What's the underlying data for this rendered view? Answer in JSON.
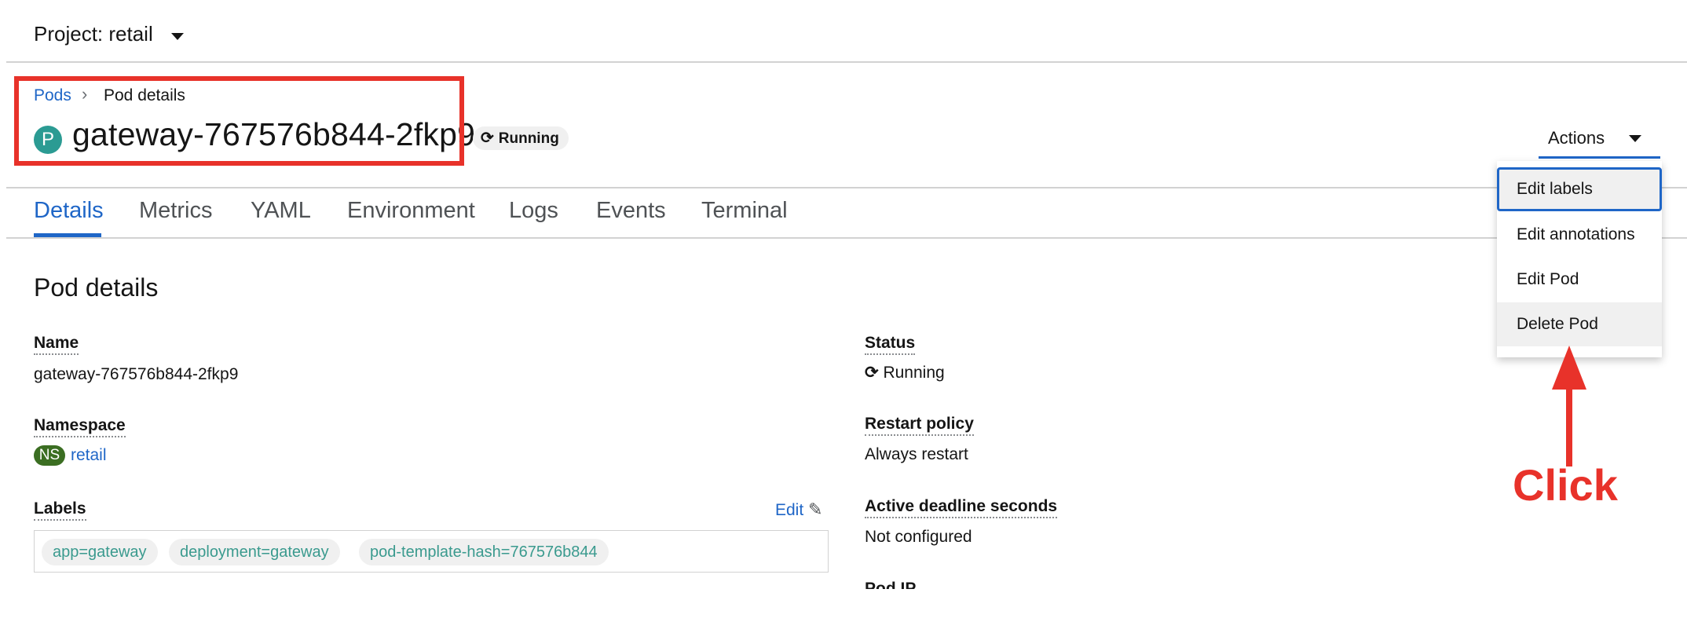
{
  "project": {
    "label": "Project: retail"
  },
  "breadcrumb": {
    "root": "Pods",
    "separator": "›",
    "current": "Pod details"
  },
  "header": {
    "badge": "P",
    "pod_name": "gateway-767576b844-2fkp9",
    "status": "Running",
    "actions_label": "Actions"
  },
  "tabs": [
    "Details",
    "Metrics",
    "YAML",
    "Environment",
    "Logs",
    "Events",
    "Terminal"
  ],
  "actions_menu": {
    "items": [
      "Edit labels",
      "Edit annotations",
      "Edit Pod",
      "Delete Pod"
    ]
  },
  "details": {
    "section_title": "Pod details",
    "name": {
      "label": "Name",
      "value": "gateway-767576b844-2fkp9"
    },
    "namespace": {
      "label": "Namespace",
      "badge": "NS",
      "value": "retail"
    },
    "labels": {
      "label": "Labels",
      "edit_label": "Edit",
      "chips": [
        "app=gateway",
        "deployment=gateway",
        "pod-template-hash=767576b844"
      ]
    },
    "status": {
      "label": "Status",
      "value": "Running"
    },
    "restart_policy": {
      "label": "Restart policy",
      "value": "Always restart"
    },
    "active_deadline": {
      "label": "Active deadline seconds",
      "value": "Not configured"
    },
    "pod_ip": {
      "label": "Pod IP"
    }
  },
  "annotation": {
    "text": "Click"
  },
  "colors": {
    "accent": "#1f66c7",
    "annotation": "#e8322a",
    "pod_badge": "#2b9b93",
    "ns_badge": "#3b6e22"
  }
}
